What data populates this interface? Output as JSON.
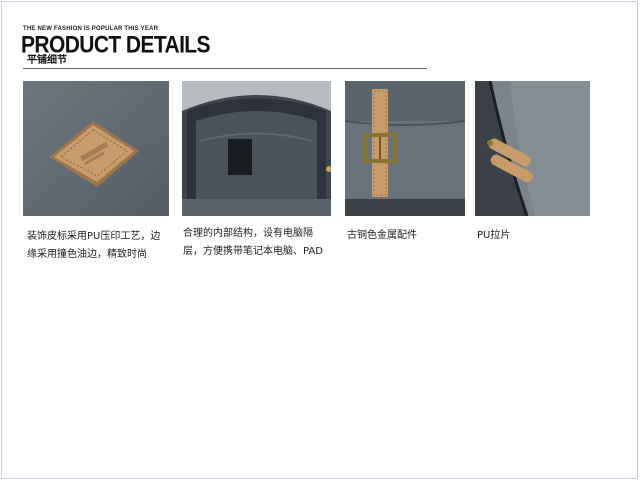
{
  "header": {
    "tagline": "THE NEW FASHION IS POPULAR THIS YEAR",
    "title": "PRODUCT DETAILS",
    "subtitle": "平铺细节"
  },
  "details": [
    {
      "caption": "装饰皮标采用PU压印工艺，边缘采用撞色油边，精致时尚"
    },
    {
      "caption": "合理的内部结构，设有电脑隔层，方便携带笔记本电脑、PAD"
    },
    {
      "caption": "古铜色金属配件"
    },
    {
      "caption": "PU拉片"
    }
  ],
  "colors": {
    "fabric": "#5f6870",
    "leather": "#c89b6a",
    "brass": "#8a7434",
    "frame_border": "#c9d3e6"
  }
}
